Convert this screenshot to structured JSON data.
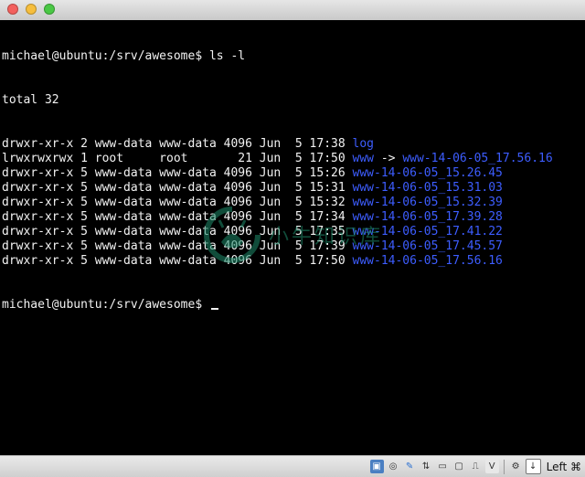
{
  "terminal": {
    "prompt": "michael@ubuntu:/srv/awesome$",
    "command": " ls -l",
    "total": "total 32",
    "rows": [
      {
        "meta": "drwxr-xr-x 2 www-data www-data 4096 Jun  5 17:38 ",
        "name": "log",
        "arrow": "",
        "target": ""
      },
      {
        "meta": "lrwxrwxrwx 1 root     root       21 Jun  5 17:50 ",
        "name": "www",
        "arrow": " -> ",
        "target": "www-14-06-05_17.56.16"
      },
      {
        "meta": "drwxr-xr-x 5 www-data www-data 4096 Jun  5 15:26 ",
        "name": "www-14-06-05_15.26.45",
        "arrow": "",
        "target": ""
      },
      {
        "meta": "drwxr-xr-x 5 www-data www-data 4096 Jun  5 15:31 ",
        "name": "www-14-06-05_15.31.03",
        "arrow": "",
        "target": ""
      },
      {
        "meta": "drwxr-xr-x 5 www-data www-data 4096 Jun  5 15:32 ",
        "name": "www-14-06-05_15.32.39",
        "arrow": "",
        "target": ""
      },
      {
        "meta": "drwxr-xr-x 5 www-data www-data 4096 Jun  5 17:34 ",
        "name": "www-14-06-05_17.39.28",
        "arrow": "",
        "target": ""
      },
      {
        "meta": "drwxr-xr-x 5 www-data www-data 4096 Jun  5 17:35 ",
        "name": "www-14-06-05_17.41.22",
        "arrow": "",
        "target": ""
      },
      {
        "meta": "drwxr-xr-x 5 www-data www-data 4096 Jun  5 17:39 ",
        "name": "www-14-06-05_17.45.57",
        "arrow": "",
        "target": ""
      },
      {
        "meta": "drwxr-xr-x 5 www-data www-data 4096 Jun  5 17:50 ",
        "name": "www-14-06-05_17.56.16",
        "arrow": "",
        "target": ""
      }
    ],
    "prompt2": "michael@ubuntu:/srv/awesome$ "
  },
  "watermark": {
    "text": "小牛知识库",
    "icon": "bull-logo-icon"
  },
  "statusbar": {
    "icons": [
      "hdd-icon",
      "cd-icon",
      "pencil-icon",
      "usb-icon",
      "folder-icon",
      "display-icon",
      "network-icon",
      "capture-icon",
      "settings-icon",
      "arrow-down-icon"
    ],
    "hostkey": "Left ⌘"
  },
  "colors": {
    "dir": "#3d5dff",
    "text": "#f2f2f2",
    "background": "#000000",
    "watermark": "#1e8a6a"
  }
}
